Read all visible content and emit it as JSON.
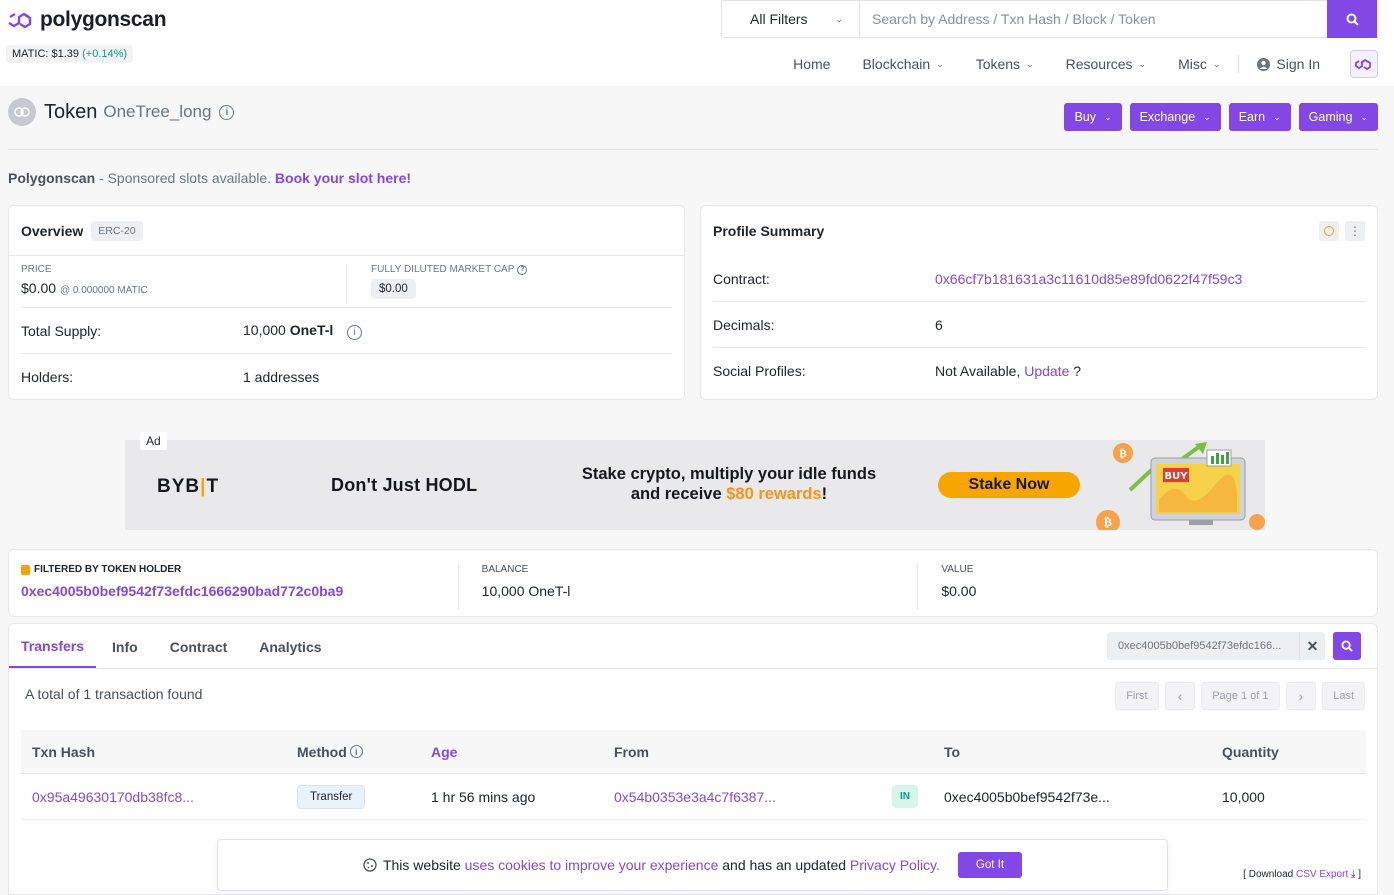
{
  "header": {
    "logo_text": "polygonscan",
    "matic_price_label": "MATIC: $1.39",
    "matic_change": "(+0.14%)",
    "filter_label": "All Filters",
    "search_placeholder": "Search by Address / Txn Hash / Block / Token",
    "nav": [
      {
        "label": "Home"
      },
      {
        "label": "Blockchain"
      },
      {
        "label": "Tokens"
      },
      {
        "label": "Resources"
      },
      {
        "label": "Misc"
      },
      {
        "label": "Sign In"
      }
    ]
  },
  "page": {
    "title": "Token",
    "token_name": "OneTree_long",
    "actions": [
      "Buy",
      "Exchange",
      "Earn",
      "Gaming"
    ]
  },
  "sponsor": {
    "brand": "Polygonscan",
    "text": " - Sponsored slots available. ",
    "link": "Book your slot here!"
  },
  "overview": {
    "title": "Overview",
    "badge": "ERC-20",
    "price_label": "PRICE",
    "price_value": "$0.00",
    "price_matic": "@ 0.000000 MATIC",
    "mcap_label": "FULLY DILUTED MARKET CAP",
    "mcap_value": "$0.00",
    "supply_label": "Total Supply:",
    "supply_value": "10,000",
    "supply_symbol": "OneT-l",
    "holders_label": "Holders:",
    "holders_value": "1 addresses"
  },
  "profile": {
    "title": "Profile Summary",
    "contract_label": "Contract:",
    "contract_value": "0x66cf7b181631a3c11610d85e89fd0622f47f59c3",
    "decimals_label": "Decimals:",
    "decimals_value": "6",
    "social_label": "Social Profiles:",
    "social_value": "Not Available, ",
    "social_link": "Update",
    "social_suffix": " ?"
  },
  "ad": {
    "tag": "Ad",
    "brand_left": "BYB",
    "brand_right": "T",
    "headline": "Don't Just HODL",
    "stake_line1": "Stake crypto, multiply your idle funds",
    "stake_line2_pre": "and receive ",
    "stake_line2_hl": "$80 rewards",
    "stake_line2_post": "!",
    "button": "Stake Now",
    "art_label": "BUY"
  },
  "filter": {
    "holder_label": "FILTERED BY TOKEN HOLDER",
    "holder_value": "0xec4005b0bef9542f73efdc1666290bad772c0ba9",
    "balance_label": "BALANCE",
    "balance_value": "10,000 OneT-l",
    "value_label": "VALUE",
    "value_value": "$0.00"
  },
  "tabs": {
    "items": [
      "Transfers",
      "Info",
      "Contract",
      "Analytics"
    ],
    "search_value": "0xec4005b0bef9542f73efdc166..."
  },
  "transfers": {
    "total_text": "A total of 1 transaction found",
    "pager": [
      "First",
      "‹",
      "Page 1 of 1",
      "›",
      "Last"
    ],
    "columns": [
      "Txn Hash",
      "Method",
      "Age",
      "From",
      "",
      "To",
      "Quantity"
    ],
    "rows": [
      {
        "hash": "0x95a49630170db38fc8...",
        "method": "Transfer",
        "age": "1 hr 56 mins ago",
        "from": "0x54b0353e3a4c7f6387...",
        "direction": "IN",
        "to": "0xec4005b0bef9542f73e...",
        "quantity": "10,000"
      }
    ],
    "csv_pre": "[ Download ",
    "csv_link": "CSV Export",
    "csv_post": " ]"
  },
  "cookie": {
    "text1": "This website ",
    "link1": "uses cookies to improve your experience",
    "text2": " and has an updated ",
    "link2": "Privacy Policy.",
    "button": "Got It"
  },
  "colors": {
    "accent": "#8247e5",
    "positive": "#00a186"
  }
}
